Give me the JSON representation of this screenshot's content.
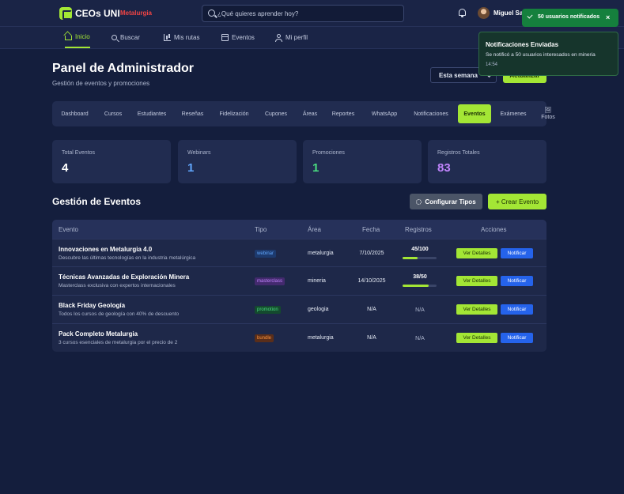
{
  "header": {
    "brand": "CEOs UNI",
    "brand_tag": "Metalurgia",
    "search_placeholder": "¿Qué quieres aprender hoy?",
    "user_name": "Miguel Sa"
  },
  "nav": {
    "items": [
      {
        "label": "Inicio",
        "icon": "home-icon",
        "active": true
      },
      {
        "label": "Buscar",
        "icon": "search-icon"
      },
      {
        "label": "Mis rutas",
        "icon": "chart-icon"
      },
      {
        "label": "Eventos",
        "icon": "calendar-icon"
      },
      {
        "label": "Mi perfil",
        "icon": "user-icon"
      }
    ]
  },
  "page": {
    "title": "Panel de Administrador",
    "subtitle": "Gestión de eventos y promociones",
    "period": "Esta semana",
    "update_label": "Actualizar"
  },
  "tabs": [
    "Dashboard",
    "Cursos",
    "Estudiantes",
    "Reseñas",
    "Fidelización",
    "Cupones",
    "Áreas",
    "Reportes",
    "WhatsApp",
    "Notificaciones",
    "Eventos",
    "Exámenes",
    "Fotos"
  ],
  "active_tab": "Eventos",
  "stats": [
    {
      "label": "Total Eventos",
      "value": "4",
      "color": "#ffffff"
    },
    {
      "label": "Webinars",
      "value": "1",
      "color": "#60a5fa"
    },
    {
      "label": "Promociones",
      "value": "1",
      "color": "#4ade80"
    },
    {
      "label": "Registros Totales",
      "value": "83",
      "color": "#c084fc"
    }
  ],
  "events": {
    "section_title": "Gestión de Eventos",
    "config_label": "Configurar Tipos",
    "create_label": "+ Crear Evento",
    "columns": [
      "Evento",
      "Tipo",
      "Área",
      "Fecha",
      "Registros",
      "Acciones"
    ],
    "detail_label": "Ver Detalles",
    "notify_label": "Notificar",
    "rows": [
      {
        "title": "Innovaciones en Metalurgia 4.0",
        "desc": "Descubre las últimas tecnologías en la industria metalúrgica",
        "type": "webinar",
        "area": "metalurgia",
        "date": "7/10/2025",
        "registrations": "45/100",
        "progress": 0.45
      },
      {
        "title": "Técnicas Avanzadas de Exploración Minera",
        "desc": "Masterclass exclusiva con expertos internacionales",
        "type": "masterclass",
        "area": "mineria",
        "date": "14/10/2025",
        "registrations": "38/50",
        "progress": 0.76
      },
      {
        "title": "Black Friday Geología",
        "desc": "Todos los cursos de geología con 40% de descuento",
        "type": "promotion",
        "area": "geologia",
        "date": "N/A",
        "registrations": "N/A",
        "progress": null
      },
      {
        "title": "Pack Completo Metalurgia",
        "desc": "3 cursos esenciales de metalurgia por el precio de 2",
        "type": "bundle",
        "area": "metalurgia",
        "date": "N/A",
        "registrations": "N/A",
        "progress": null
      }
    ]
  },
  "toasts": {
    "success": "50 usuarios notificados",
    "info_title": "Notificaciones Enviadas",
    "info_message": "Se notificó a 50 usuarios interesados en mineria",
    "info_time": "14:54"
  }
}
